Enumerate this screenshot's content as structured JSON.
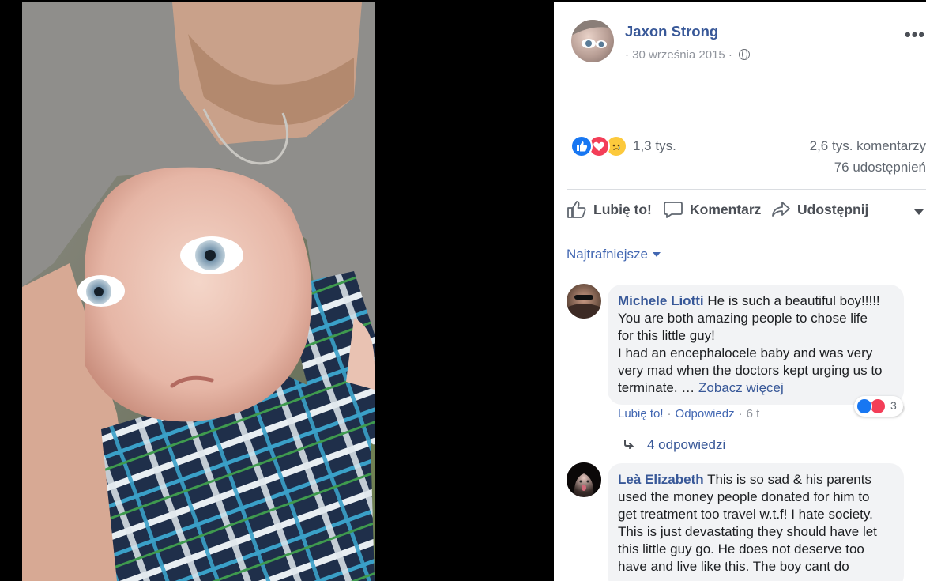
{
  "post": {
    "author": "Jaxon Strong",
    "date_prefix": "·",
    "date": "30 września 2015",
    "date_suffix": "·",
    "reactions_count": "1,3 tys.",
    "comments_count": "2,6 tys. komentarzy",
    "shares_count": "76 udostępnień"
  },
  "actions": {
    "like": "Lubię to!",
    "comment": "Komentarz",
    "share": "Udostępnij"
  },
  "sort": {
    "label": "Najtrafniejsze"
  },
  "comments": [
    {
      "name": "Michele Liotti",
      "lines": [
        "He is such a beautiful boy!!!!!",
        "You are both amazing people to chose life",
        "for this little guy!",
        "I had an encephalocele baby and was very",
        "very mad when the doctors kept urging us to",
        "terminate. …"
      ],
      "see_more": "Zobacz więcej",
      "like_label": "Lubię to!",
      "reply_label": "Odpowiedz",
      "time": "6 t",
      "reaction_count": "3",
      "replies": "4 odpowiedzi"
    },
    {
      "name": "Leà Elizabeth",
      "lines": [
        "This is so sad & his parents",
        "used the money people donated for him to",
        "get treatment too travel w.t.f! I hate society.",
        "This is just devastating they should have let",
        "this little guy go. He does not deserve too",
        "have and live like this. The boy cant do"
      ]
    }
  ],
  "colors": {
    "link": "#385898",
    "like_blue": "#1877f2",
    "love_red": "#f33e58",
    "bubble_bg": "#f2f3f5"
  },
  "icons": [
    "globe-icon",
    "more-icon",
    "thumb-up-icon",
    "speech-bubble-icon",
    "share-arrow-icon",
    "reply-arrow-icon"
  ]
}
